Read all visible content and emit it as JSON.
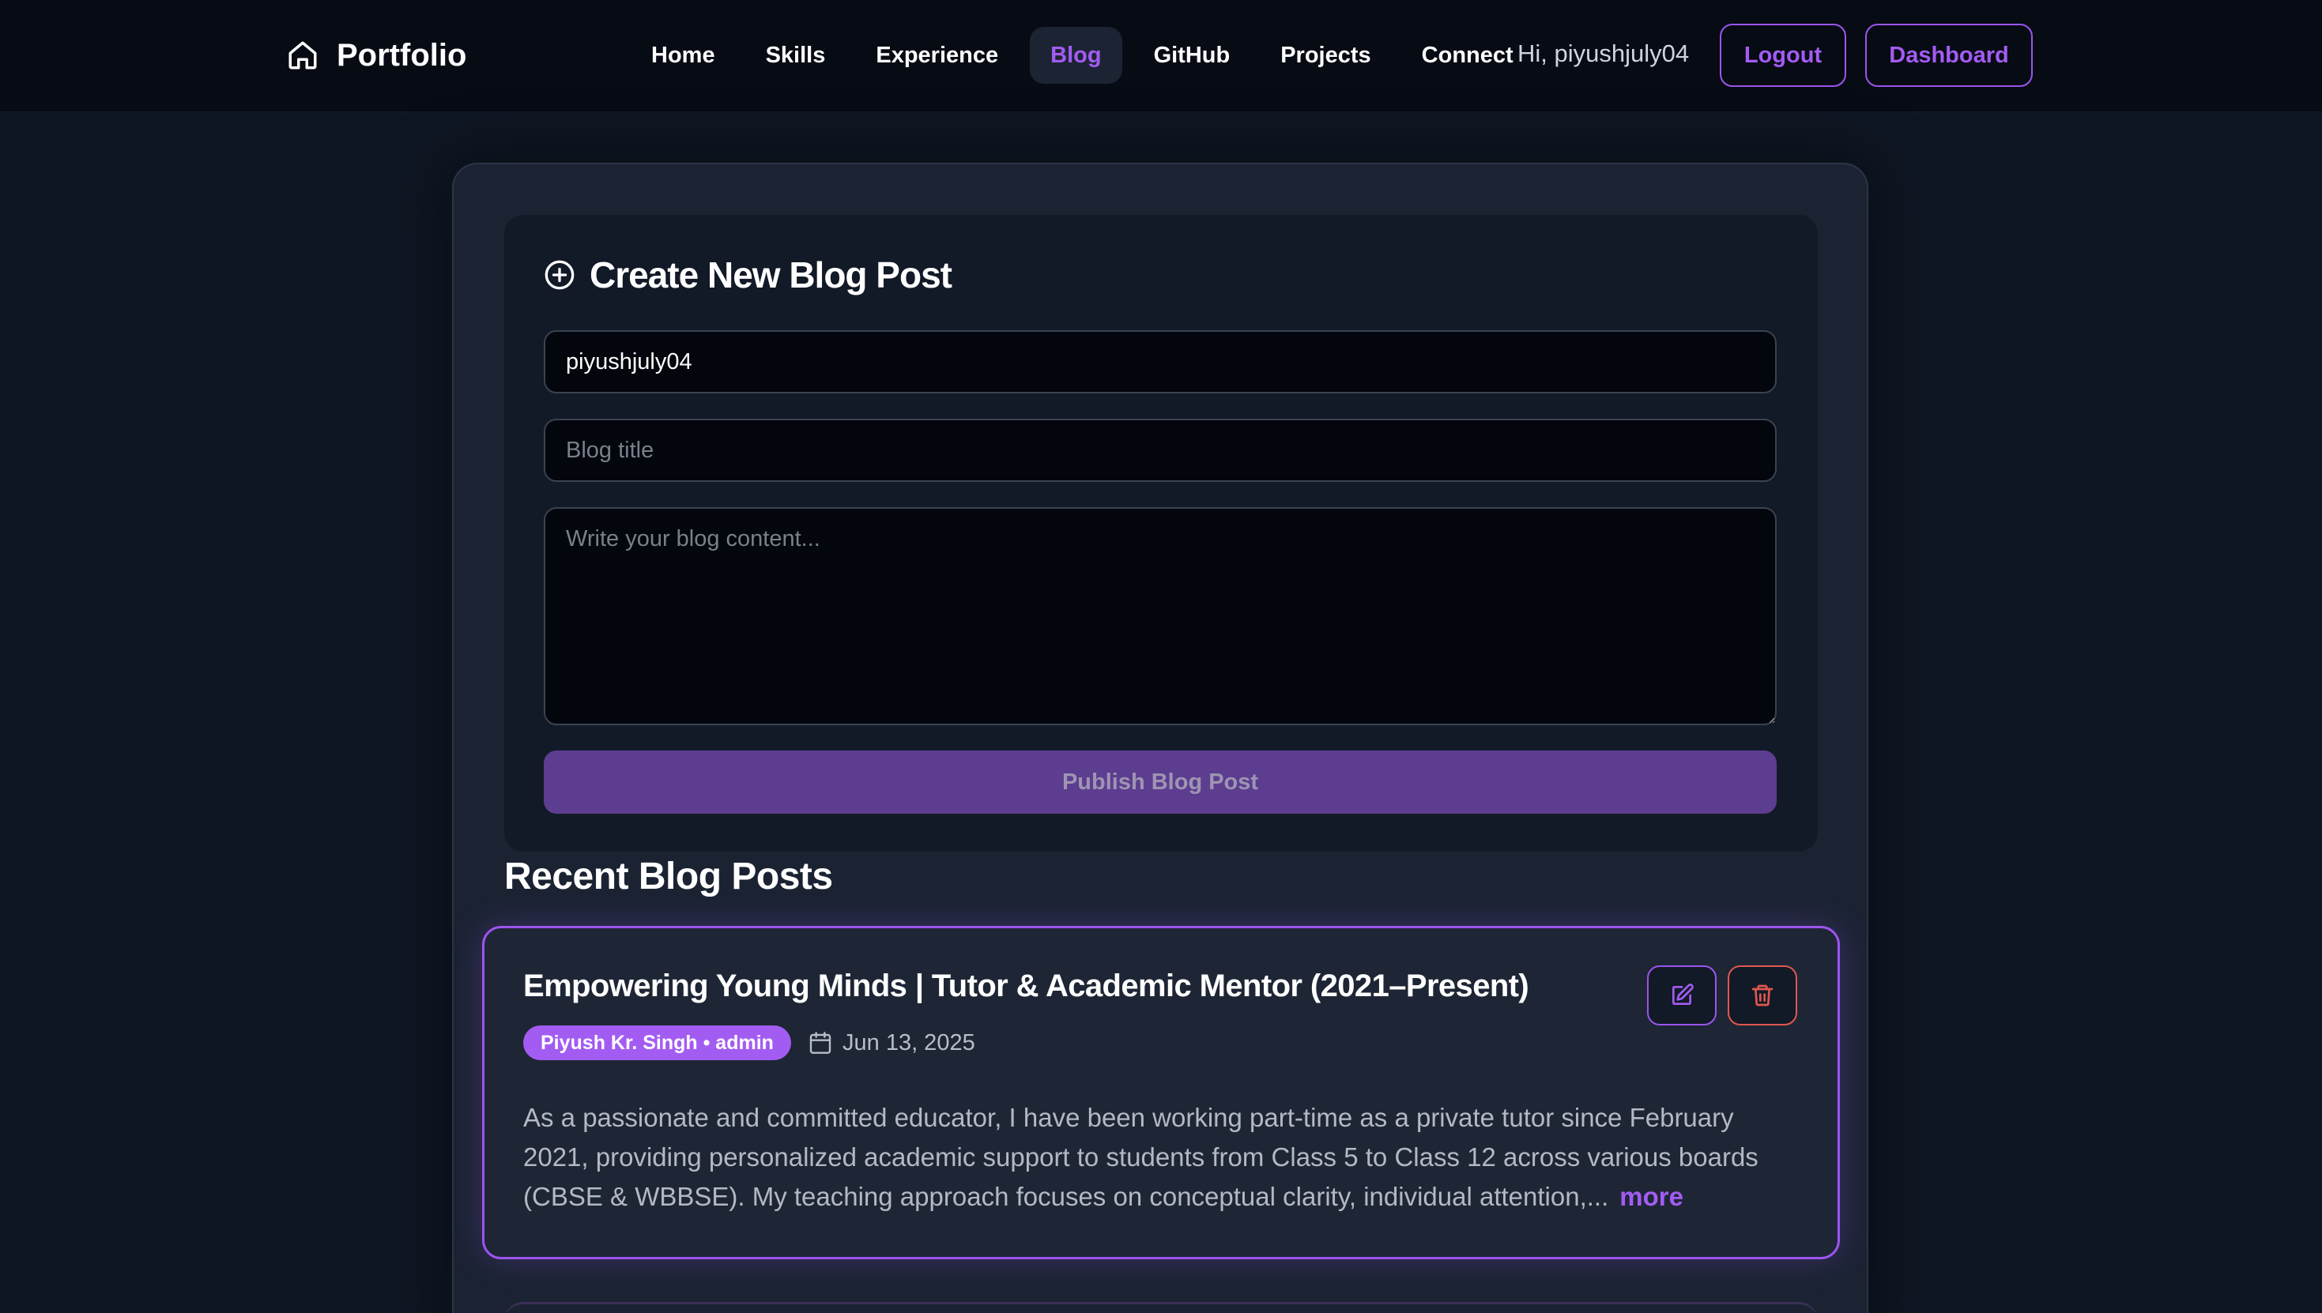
{
  "navbar": {
    "brand": "Portfolio",
    "links": [
      "Home",
      "Skills",
      "Experience",
      "Blog",
      "GitHub",
      "Projects",
      "Connect"
    ],
    "active_link": "Blog",
    "greeting": "Hi, piyushjuly04",
    "logout_label": "Logout",
    "dashboard_label": "Dashboard"
  },
  "create_post": {
    "title": "Create New Blog Post",
    "author_value": "piyushjuly04",
    "title_placeholder": "Blog title",
    "content_placeholder": "Write your blog content...",
    "publish_label": "Publish Blog Post"
  },
  "recent": {
    "heading": "Recent Blog Posts",
    "posts": [
      {
        "title": "Empowering Young Minds | Tutor & Academic Mentor (2021–Present)",
        "author_badge": "Piyush Kr. Singh • admin",
        "date": "Jun 13, 2025",
        "excerpt": "As a passionate and committed educator, I have been working part-time as a private tutor since February 2021, providing personalized academic support to students from Class 5 to Class 12 across various boards (CBSE & WBBSE). My teaching approach focuses on conceptual clarity, individual attention,...",
        "more_label": "more"
      }
    ]
  },
  "colors": {
    "accent": "#a35cf2",
    "danger": "#e0574f",
    "background": "#0f1623"
  }
}
